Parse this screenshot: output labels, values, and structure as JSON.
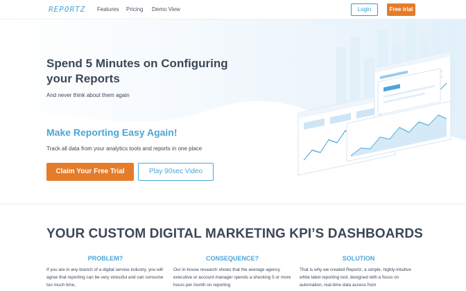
{
  "nav": {
    "logo": "REPORTZ",
    "links": [
      "Features",
      "Pricing",
      "Demo View"
    ],
    "login_label": "Login",
    "trial_label": "Free trial"
  },
  "hero": {
    "title": "Spend 5 Minutes on Configuring your Reports",
    "subtitle": "And never think about them again",
    "tagline": "Make Reporting Easy Again!",
    "tagline_sub": "Track all data from your analytics tools and reports in one place",
    "cta_primary": "Claim Your Free Trial",
    "cta_secondary": "Play 90sec Video"
  },
  "section": {
    "title": "YOUR CUSTOM DIGITAL MARKETING KPI’S DASHBOARDS",
    "columns": [
      {
        "heading": "PROBLEM?",
        "text": "If you are in any branch of a digital service industry, you will agree that reporting can be very stressful and can consume too much time,"
      },
      {
        "heading": "CONSEQUENCE?",
        "text": "Our in-house research shows that the average agency executive or account manager spends a shocking 5 or more hours per month on reporting"
      },
      {
        "heading": "SOLUTION",
        "text": "That is why we created Reportz, a simple, highly-intuitive white label reporting tool, designed with a focus on automation, real-time data access from"
      }
    ]
  },
  "colors": {
    "accent_blue": "#4aa6d8",
    "accent_orange": "#e57c2a",
    "text_dark": "#3b4756"
  }
}
